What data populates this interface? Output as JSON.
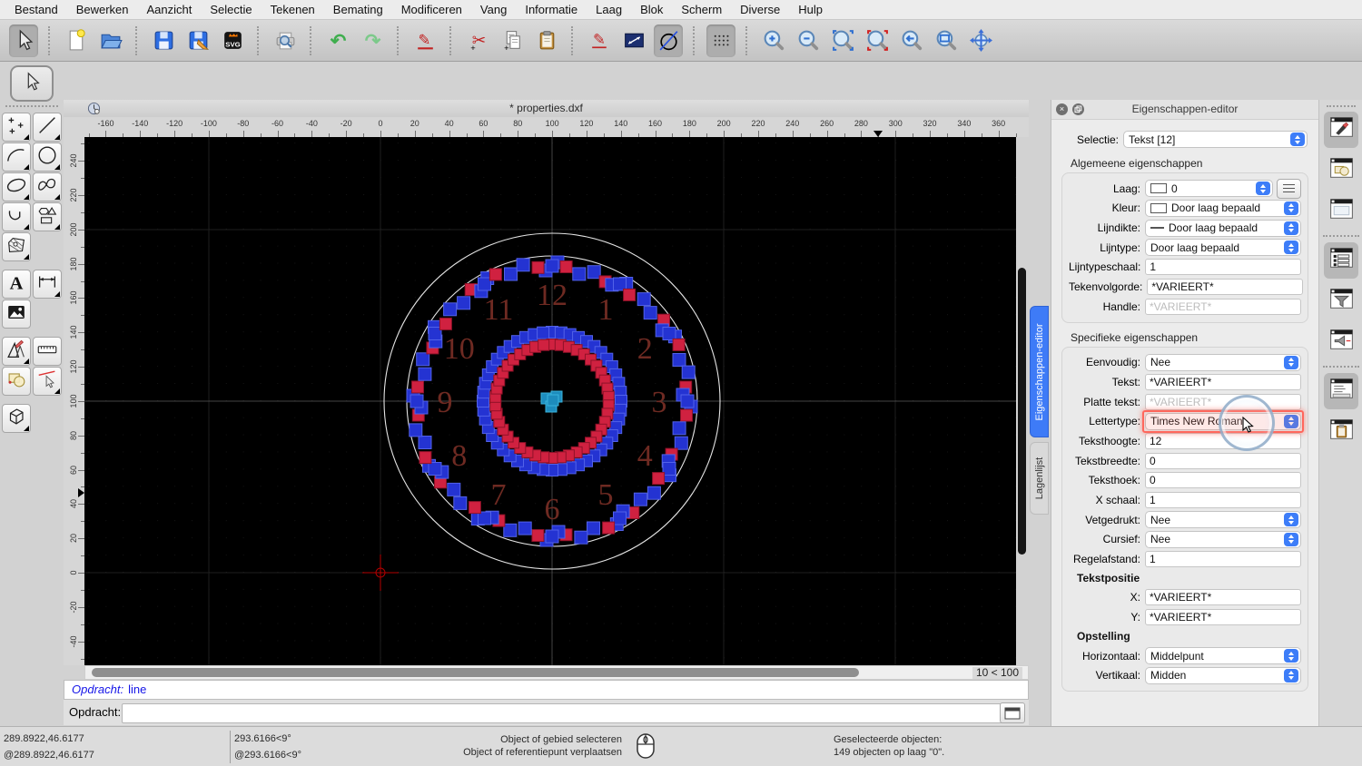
{
  "menu_bar": {
    "items": [
      "Bestand",
      "Bewerken",
      "Aanzicht",
      "Selectie",
      "Tekenen",
      "Bemating",
      "Modificeren",
      "Vang",
      "Informatie",
      "Laag",
      "Blok",
      "Scherm",
      "Diverse",
      "Hulp"
    ]
  },
  "toolbar": {
    "buttons": [
      {
        "name": "select-pointer",
        "pressed": true
      },
      {
        "type": "sep"
      },
      {
        "name": "new-file"
      },
      {
        "name": "open-file"
      },
      {
        "type": "sep"
      },
      {
        "name": "save-file"
      },
      {
        "name": "save-file-as"
      },
      {
        "name": "svg-export"
      },
      {
        "type": "sep"
      },
      {
        "name": "print-preview"
      },
      {
        "type": "sep"
      },
      {
        "name": "undo"
      },
      {
        "name": "redo"
      },
      {
        "type": "sep"
      },
      {
        "name": "delete-entity"
      },
      {
        "type": "sep"
      },
      {
        "name": "cut"
      },
      {
        "name": "copy"
      },
      {
        "name": "paste"
      },
      {
        "type": "sep"
      },
      {
        "name": "pen-edit"
      },
      {
        "name": "measure-distance"
      },
      {
        "name": "circle-tool",
        "pressed": true
      },
      {
        "type": "sep"
      },
      {
        "name": "grid-toggle",
        "pressed": true
      },
      {
        "type": "sep"
      },
      {
        "name": "zoom-in"
      },
      {
        "name": "zoom-out"
      },
      {
        "name": "zoom-auto"
      },
      {
        "name": "zoom-previous"
      },
      {
        "name": "zoom-back"
      },
      {
        "name": "zoom-window"
      },
      {
        "name": "zoom-pan"
      }
    ]
  },
  "left_palette": {
    "tools": [
      {
        "name": "points",
        "sub": true
      },
      {
        "name": "line",
        "sub": true
      },
      {
        "name": "arc",
        "sub": true
      },
      {
        "name": "circle",
        "sub": true
      },
      {
        "name": "ellipse",
        "sub": true
      },
      {
        "name": "spline",
        "sub": true
      },
      {
        "name": "polyline",
        "sub": true
      },
      {
        "name": "shapes",
        "sub": true
      },
      {
        "name": "hatch",
        "sub": true
      },
      {
        "name": null
      },
      {
        "type": "gap"
      },
      {
        "name": "text"
      },
      {
        "name": "dimension",
        "sub": true
      },
      {
        "name": "image"
      },
      {
        "name": null
      },
      {
        "type": "gap"
      },
      {
        "name": "modify",
        "sub": true
      },
      {
        "name": "measure"
      },
      {
        "name": "block"
      },
      {
        "name": "deselect",
        "sub": true
      },
      {
        "type": "gap"
      },
      {
        "name": "solid-3d",
        "sub": true
      },
      {
        "name": null
      }
    ]
  },
  "document": {
    "title": "* properties.dxf",
    "zoom_indicator": "10 < 100",
    "h_ruler_labels": [
      -160,
      -140,
      -120,
      -100,
      -80,
      -60,
      -40,
      -20,
      0,
      20,
      40,
      60,
      80,
      100,
      120,
      140,
      160,
      180,
      200,
      220,
      240,
      260,
      280,
      300,
      320,
      340,
      360
    ],
    "v_ruler_labels": [
      240,
      220,
      200,
      180,
      160,
      140,
      120,
      100,
      80,
      60,
      40,
      20,
      0,
      -20,
      -40
    ],
    "h_marker_value": 289.89,
    "v_marker_value": 46.62
  },
  "drawing": {
    "background": "#000000",
    "grid_dot_color": "#2c2c2c",
    "metagrid_color": "#1e1e1e",
    "crosshair_color": "#454545",
    "origin_marker_color": "#b40000",
    "clock": {
      "numerals": [
        "12",
        "1",
        "2",
        "3",
        "4",
        "5",
        "6",
        "7",
        "8",
        "9",
        "10",
        "11"
      ],
      "numeral_color": "#6e2a22",
      "circle_color": "#e4e4e4",
      "blue": "#2433d2",
      "blue_edge": "#5262e8",
      "red": "#d02140",
      "red_edge": "#8f1228",
      "center_color": "#1d8cbd",
      "center_edge": "#39b4dd"
    }
  },
  "right_tabs": {
    "tabs": [
      {
        "label": "Eigenschappen-editor",
        "active": true
      },
      {
        "label": "Lagenlijst",
        "active": false
      }
    ]
  },
  "properties_panel": {
    "title": "Eigenschappen-editor",
    "selection_label": "Selectie:",
    "selection_value": "Tekst [12]",
    "general_section": "Algemeene eigenschappen",
    "general_fields": [
      {
        "label": "Laag:",
        "value": "0",
        "control": "dropdown",
        "swatch": "box",
        "menu_button": true
      },
      {
        "label": "Kleur:",
        "value": "Door laag bepaald",
        "control": "dropdown",
        "swatch": "box"
      },
      {
        "label": "Lijndikte:",
        "value": "Door laag bepaald",
        "control": "dropdown",
        "swatch": "line"
      },
      {
        "label": "Lijntype:",
        "value": "Door laag bepaald",
        "control": "dropdown"
      },
      {
        "label": "Lijntypeschaal:",
        "value": "1",
        "control": "input"
      },
      {
        "label": "Tekenvolgorde:",
        "value": "*VARIEERT*",
        "control": "input"
      },
      {
        "label": "Handle:",
        "value": "*VARIEERT*",
        "control": "input",
        "disabled": true
      }
    ],
    "specific_section": "Specifieke eigenschappen",
    "specific_fields": [
      {
        "label": "Eenvoudig:",
        "value": "Nee",
        "control": "dropdown"
      },
      {
        "label": "Tekst:",
        "value": "*VARIEERT*",
        "control": "input"
      },
      {
        "label": "Platte tekst:",
        "value": "*VARIEERT*",
        "control": "input",
        "disabled": true
      },
      {
        "label": "Lettertype:",
        "value": "Times New Roman",
        "control": "dropdown",
        "highlight": true
      },
      {
        "label": "Teksthoogte:",
        "value": "12",
        "control": "input"
      },
      {
        "label": "Tekstbreedte:",
        "value": "0",
        "control": "input"
      },
      {
        "label": "Teksthoek:",
        "value": "0",
        "control": "input"
      },
      {
        "label": "X schaal:",
        "value": "1",
        "control": "input"
      },
      {
        "label": "Vetgedrukt:",
        "value": "Nee",
        "control": "dropdown"
      },
      {
        "label": "Cursief:",
        "value": "Nee",
        "control": "dropdown"
      },
      {
        "label": "Regelafstand:",
        "value": "1",
        "control": "input"
      },
      {
        "type": "header",
        "label": "Tekstpositie"
      },
      {
        "label": "X:",
        "value": "*VARIEERT*",
        "control": "input"
      },
      {
        "label": "Y:",
        "value": "*VARIEERT*",
        "control": "input"
      },
      {
        "type": "header",
        "label": "Opstelling"
      },
      {
        "label": "Horizontaal:",
        "value": "Middelpunt",
        "control": "dropdown"
      },
      {
        "label": "Vertikaal:",
        "value": "Midden",
        "control": "dropdown"
      }
    ]
  },
  "dock_strip": {
    "buttons": [
      {
        "name": "pen-window",
        "active": true
      },
      {
        "name": "block-window"
      },
      {
        "name": "blank-window"
      },
      {
        "type": "sep"
      },
      {
        "name": "list-window",
        "active": true
      },
      {
        "name": "filter-window"
      },
      {
        "name": "announce-window"
      },
      {
        "type": "sep"
      },
      {
        "name": "command-window",
        "active": true
      },
      {
        "name": "clipboard-window"
      }
    ]
  },
  "command": {
    "history_label": "Opdracht:",
    "history_value": "line",
    "prompt_label": "Opdracht:",
    "input_value": ""
  },
  "status_bar": {
    "abs_coord": "289.8922,46.6177",
    "rel_coord": "@289.8922,46.6177",
    "polar_coord": "293.6166<9°",
    "polar_rel_coord": "@293.6166<9°",
    "hint_line1": "Object of gebied selecteren",
    "hint_line2": "Object of referentiepunt verplaatsen",
    "selected_line1": "Geselecteerde objecten:",
    "selected_line2": "149 objecten op laag \"0\"."
  }
}
